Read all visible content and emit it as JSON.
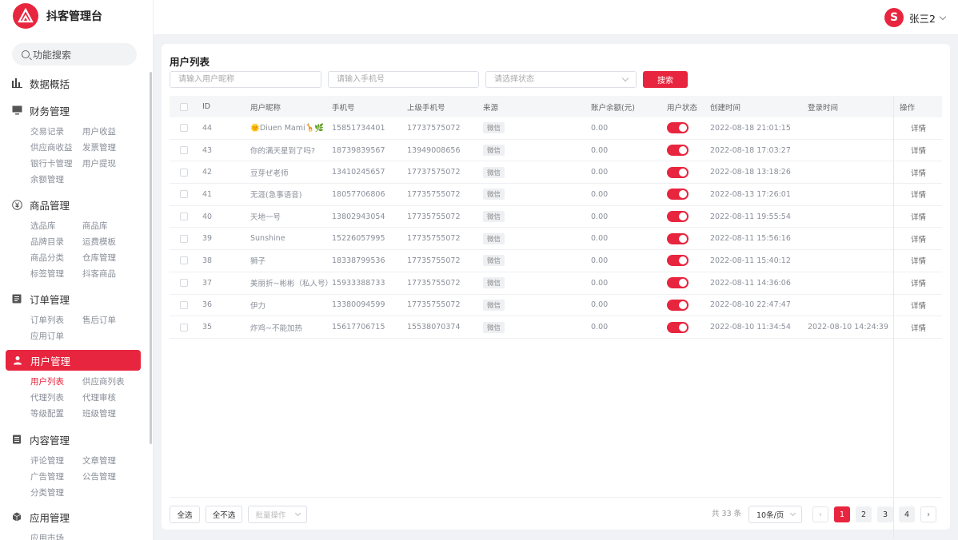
{
  "app": {
    "title": "抖客管理台"
  },
  "sidebar": {
    "search_label": "功能搜索",
    "menus": [
      {
        "label": "数据概括",
        "icon": "bar-chart-icon",
        "items": []
      },
      {
        "label": "财务管理",
        "icon": "monitor-icon",
        "items": [
          "交易记录",
          "用户收益",
          "供应商收益",
          "发票管理",
          "银行卡管理",
          "用户提现",
          "余额管理"
        ]
      },
      {
        "label": "商品管理",
        "icon": "yen-icon",
        "items": [
          "选品库",
          "商品库",
          "品牌目录",
          "运费模板",
          "商品分类",
          "仓库管理",
          "标签管理",
          "抖客商品"
        ]
      },
      {
        "label": "订单管理",
        "icon": "list-icon",
        "items": [
          "订单列表",
          "售后订单",
          "应用订单"
        ]
      },
      {
        "label": "用户管理",
        "icon": "user-icon",
        "active": true,
        "items": [
          "用户列表",
          "供应商列表",
          "代理列表",
          "代理审核",
          "等级配置",
          "班级管理"
        ],
        "current": "用户列表"
      },
      {
        "label": "内容管理",
        "icon": "document-icon",
        "items": [
          "评论管理",
          "文章管理",
          "广告管理",
          "公告管理",
          "分类管理"
        ]
      },
      {
        "label": "应用管理",
        "icon": "cube-icon",
        "items": [
          "应用市场"
        ]
      }
    ]
  },
  "header": {
    "user_name": "张三2",
    "avatar_letter": "S"
  },
  "page": {
    "title": "用户列表",
    "filters": {
      "nickname_placeholder": "请输入用户昵称",
      "phone_placeholder": "请输入手机号",
      "status_placeholder": "请选择状态",
      "search_label": "搜索"
    }
  },
  "table": {
    "columns": [
      "ID",
      "用户昵称",
      "手机号",
      "上级手机号",
      "来源",
      "账户余额(元)",
      "用户状态",
      "创建时间",
      "登录时间",
      "操作"
    ],
    "rows": [
      {
        "id": "44",
        "nickname": "🌞Diuen Mami🦒🌿",
        "phone": "15851734401",
        "parent_phone": "17737575072",
        "source": "微信",
        "balance": "0.00",
        "status": true,
        "created": "2022-08-18 21:01:15",
        "login": "",
        "action": "详情"
      },
      {
        "id": "43",
        "nickname": "你的满天星到了吗?",
        "phone": "18739839567",
        "parent_phone": "13949008656",
        "source": "微信",
        "balance": "0.00",
        "status": true,
        "created": "2022-08-18 17:03:27",
        "login": "",
        "action": "详情"
      },
      {
        "id": "42",
        "nickname": "豆芽ぜ老师",
        "phone": "13410245657",
        "parent_phone": "17737575072",
        "source": "微信",
        "balance": "0.00",
        "status": true,
        "created": "2022-08-18 13:18:26",
        "login": "",
        "action": "详情"
      },
      {
        "id": "41",
        "nickname": "无涯(急事语音)",
        "phone": "18057706806",
        "parent_phone": "17735755072",
        "source": "微信",
        "balance": "0.00",
        "status": true,
        "created": "2022-08-13 17:26:01",
        "login": "",
        "action": "详情"
      },
      {
        "id": "40",
        "nickname": "天地一号",
        "phone": "13802943054",
        "parent_phone": "17735755072",
        "source": "微信",
        "balance": "0.00",
        "status": true,
        "created": "2022-08-11 19:55:54",
        "login": "",
        "action": "详情"
      },
      {
        "id": "39",
        "nickname": "Sunshine",
        "phone": "15226057995",
        "parent_phone": "17735755072",
        "source": "微信",
        "balance": "0.00",
        "status": true,
        "created": "2022-08-11 15:56:16",
        "login": "",
        "action": "详情"
      },
      {
        "id": "38",
        "nickname": "狮子",
        "phone": "18338799536",
        "parent_phone": "17735755072",
        "source": "微信",
        "balance": "0.00",
        "status": true,
        "created": "2022-08-11 15:40:12",
        "login": "",
        "action": "详情"
      },
      {
        "id": "37",
        "nickname": "美丽折~彬彬（私人号）",
        "phone": "15933388733",
        "parent_phone": "17735755072",
        "source": "微信",
        "balance": "0.00",
        "status": true,
        "created": "2022-08-11 14:36:06",
        "login": "",
        "action": "详情"
      },
      {
        "id": "36",
        "nickname": "伊力",
        "phone": "13380094599",
        "parent_phone": "17735755072",
        "source": "微信",
        "balance": "0.00",
        "status": true,
        "created": "2022-08-10 22:47:47",
        "login": "",
        "action": "详情"
      },
      {
        "id": "35",
        "nickname": "炸鸡~不能加热",
        "phone": "15617706715",
        "parent_phone": "15538070374",
        "source": "微信",
        "balance": "0.00",
        "status": true,
        "created": "2022-08-10 11:34:54",
        "login": "2022-08-10 14:24:39",
        "action": "详情"
      }
    ]
  },
  "footer": {
    "select_all": "全选",
    "select_none": "全不选",
    "batch": "批量操作",
    "total": "共 33 条",
    "page_size": "10条/页",
    "pages": [
      "1",
      "2",
      "3",
      "4"
    ],
    "current_page": "1",
    "prev": "‹",
    "next": "›"
  },
  "colors": {
    "accent": "#e8253e"
  }
}
